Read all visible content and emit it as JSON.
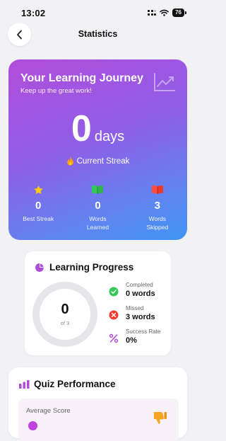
{
  "status_bar": {
    "time": "13:02",
    "battery": "76"
  },
  "header": {
    "title": "Statistics",
    "back_icon": "chevron-left-icon"
  },
  "hero": {
    "title": "Your Learning Journey",
    "subtitle": "Keep up the great work!",
    "streak_value": "0",
    "streak_unit": "days",
    "streak_label": "Current Streak",
    "stats": [
      {
        "icon": "star-icon",
        "value": "0",
        "label_lines": [
          "Best Streak"
        ]
      },
      {
        "icon": "open-book-green-icon",
        "value": "0",
        "label_lines": [
          "Words",
          "Learned"
        ]
      },
      {
        "icon": "open-book-red-icon",
        "value": "3",
        "label_lines": [
          "Words",
          "Skipped"
        ]
      }
    ],
    "colors": {
      "gradient_start": "#b24ddb",
      "gradient_end": "#3f95f6"
    }
  },
  "learning_progress": {
    "title": "Learning Progress",
    "ring_value": "0",
    "ring_caption": "of 3",
    "ring_progress_fraction": 0,
    "items": [
      {
        "icon": "check-circle-icon",
        "label": "Completed",
        "value": "0 words",
        "color": "#34c759"
      },
      {
        "icon": "x-circle-icon",
        "label": "Missed",
        "value": "3 words",
        "color": "#ff3b30"
      },
      {
        "icon": "percent-icon",
        "label": "Success Rate",
        "value": "0%",
        "color": "#b04bd8"
      }
    ]
  },
  "quiz_performance": {
    "title": "Quiz Performance",
    "average_score_label": "Average Score"
  }
}
